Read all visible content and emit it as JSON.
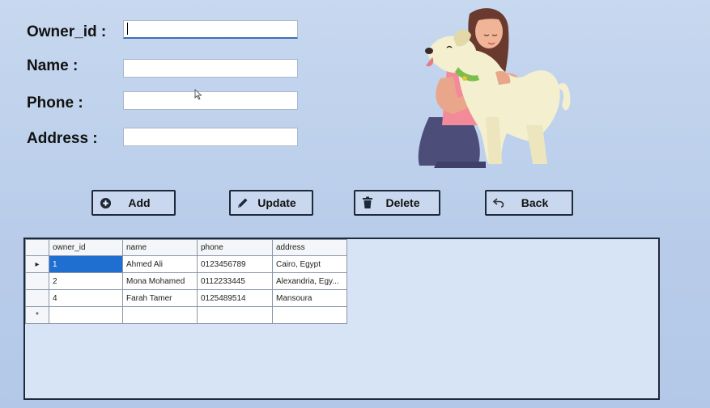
{
  "form": {
    "owner_id_label": "Owner_id :",
    "name_label": "Name :",
    "phone_label": "Phone :",
    "address_label": "Address :",
    "owner_id_value": "",
    "name_value": "",
    "phone_value": "",
    "address_value": ""
  },
  "buttons": {
    "add": "Add",
    "update": "Update",
    "delete": "Delete",
    "back": "Back"
  },
  "grid": {
    "columns": [
      "owner_id",
      "name",
      "phone",
      "address"
    ],
    "rows": [
      {
        "owner_id": "1",
        "name": "Ahmed Ali",
        "phone": "0123456789",
        "address": "Cairo, Egypt"
      },
      {
        "owner_id": "2",
        "name": "Mona Mohamed",
        "phone": "0112233445",
        "address": "Alexandria, Egy..."
      },
      {
        "owner_id": "4",
        "name": "Farah Tamer",
        "phone": "0125489514",
        "address": "Mansoura"
      }
    ],
    "current_row_marker": "▸",
    "new_row_marker": "*"
  },
  "icons": {
    "add": "plus-circle-icon",
    "update": "pencil-icon",
    "delete": "trash-icon",
    "back": "undo-arrow-icon"
  },
  "colors": {
    "background": "#bcd0ec",
    "selection": "#1f6fd1",
    "border": "#1e2a3a"
  }
}
